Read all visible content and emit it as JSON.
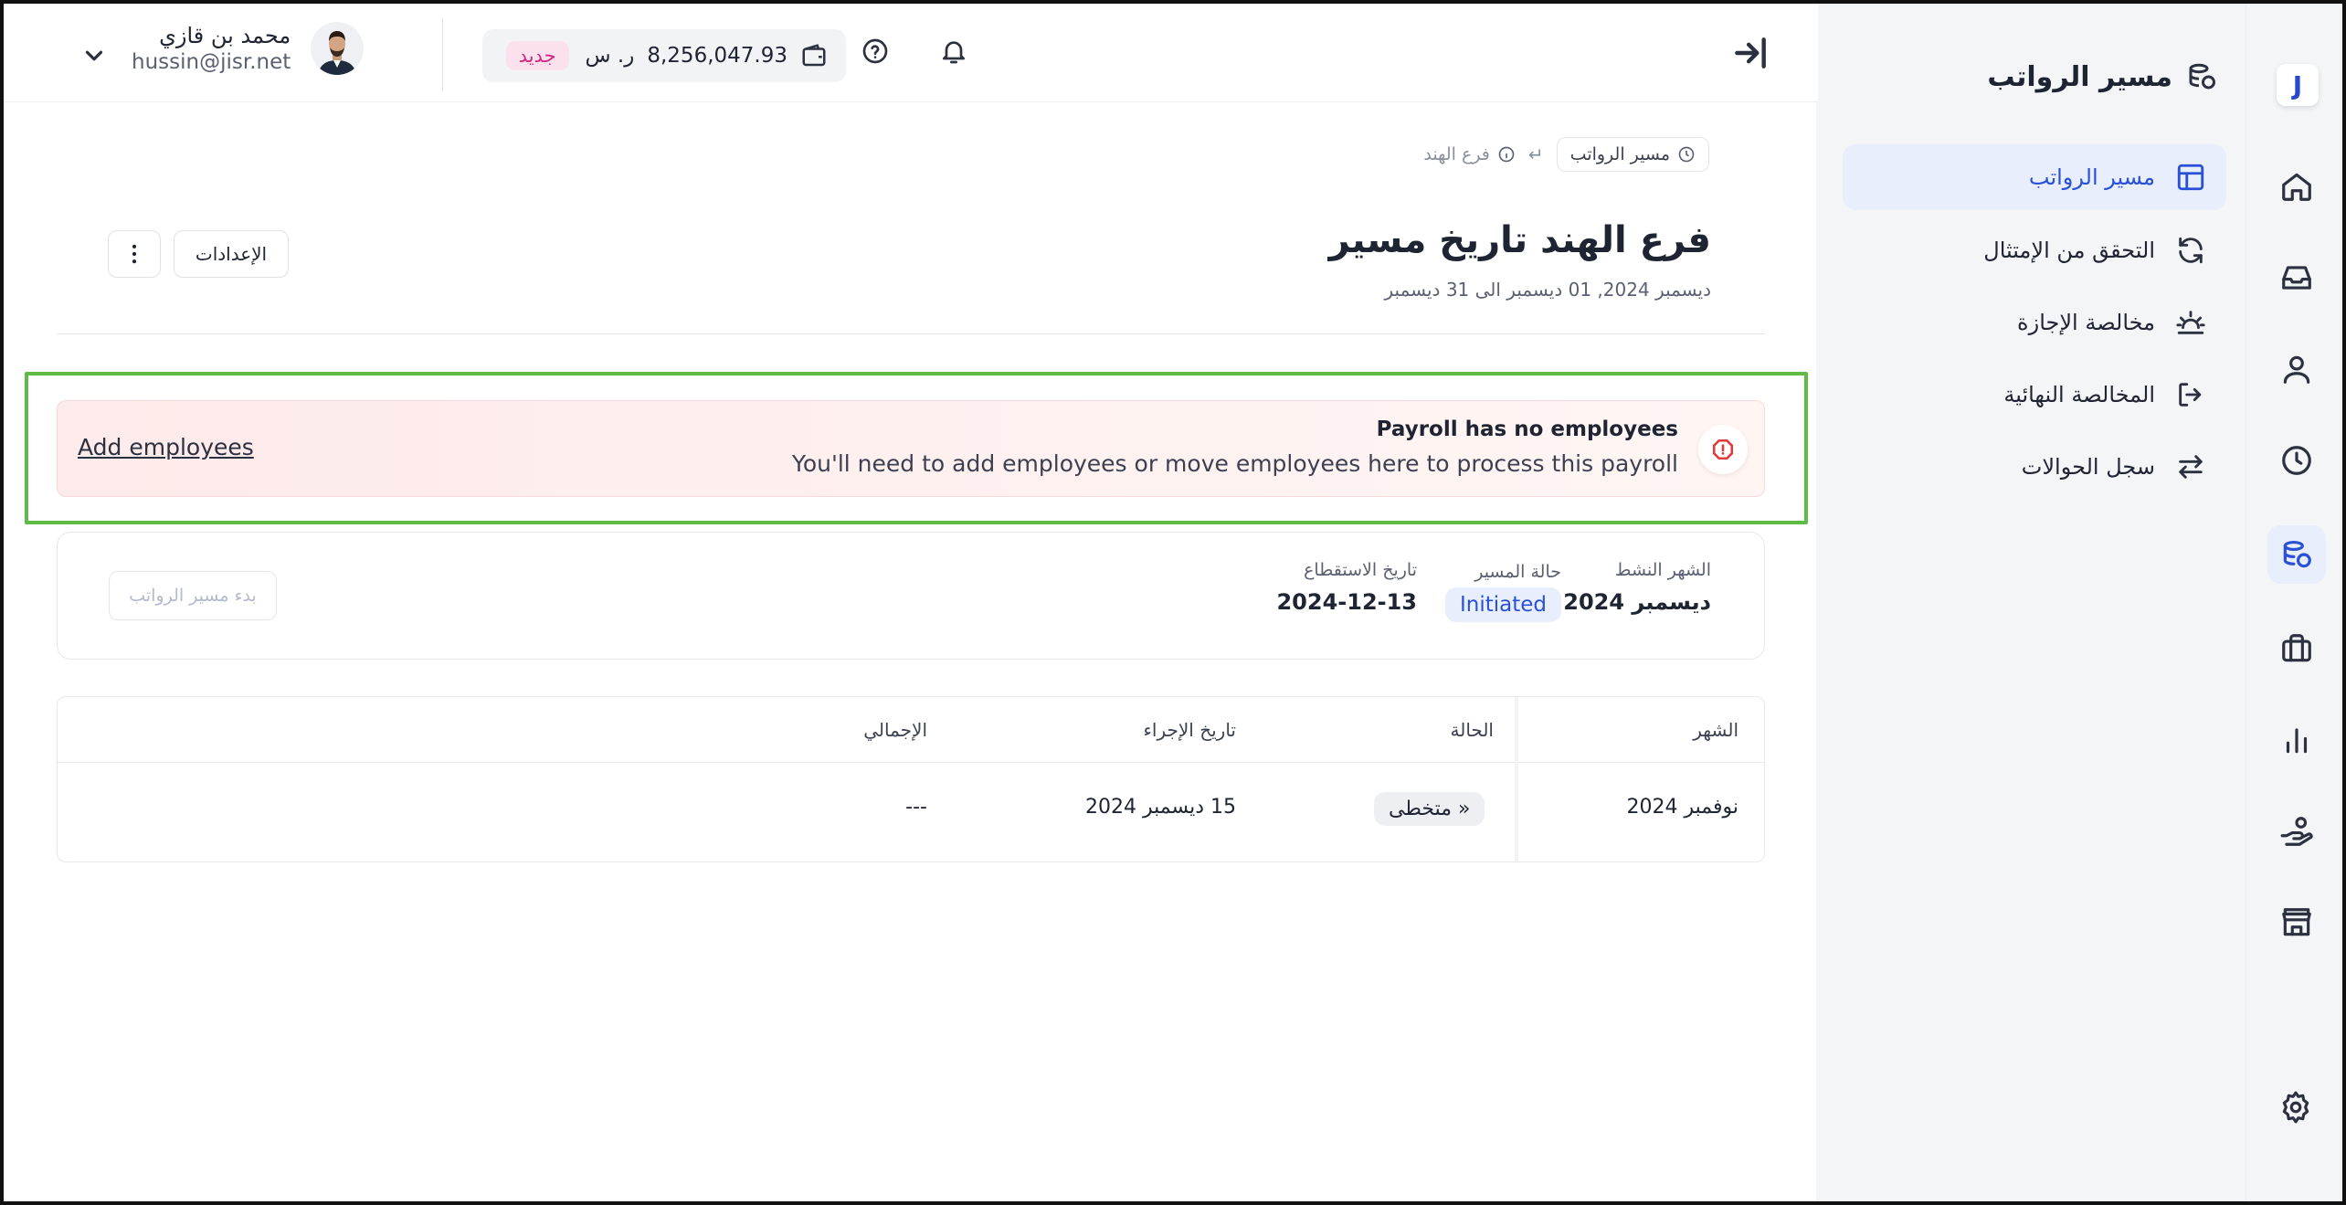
{
  "app": {
    "logo_letter": "J"
  },
  "sidebar": {
    "title": "مسير الرواتب",
    "items": [
      {
        "label": "مسير الرواتب",
        "icon": "table-icon",
        "active": true
      },
      {
        "label": "التحقق من الإمتثال",
        "icon": "refresh-icon",
        "active": false
      },
      {
        "label": "مخالصة الإجازة",
        "icon": "sunset-icon",
        "active": false
      },
      {
        "label": "المخالصة النهائية",
        "icon": "logout-icon",
        "active": false
      },
      {
        "label": "سجل الحوالات",
        "icon": "transfer-arrows-icon",
        "active": false
      }
    ]
  },
  "rail": {
    "icons": [
      "home-icon",
      "inbox-icon",
      "user-icon",
      "clock-icon",
      "coins-icon",
      "briefcase-icon",
      "bar-chart-icon",
      "hand-coin-icon",
      "store-icon",
      "settings-icon"
    ],
    "active": "coins-icon"
  },
  "topbar": {
    "balance": "8,256,047.93",
    "currency": "ر. س",
    "new_badge": "جديد",
    "user_name": "محمد بن قازي",
    "user_email": "hussin@jisr.net"
  },
  "breadcrumb": {
    "current": "مسير الرواتب",
    "parent": "فرع الهند"
  },
  "page": {
    "title": "فرع الهند تاريخ مسير",
    "subtitle": "ديسمبر 2024, 01 ديسمبر الى 31 ديسمبر",
    "settings_label": "الإعدادات"
  },
  "alert": {
    "title": "Payroll has no employees",
    "description": "You'll need to add employees or move employees here to process this payroll",
    "action": "Add employees",
    "accent_color": "#e03a3a"
  },
  "status": {
    "active_month_label": "الشهر النشط",
    "active_month_value": "ديسمبر 2024",
    "payroll_status_label": "حالة المسير",
    "payroll_status_value": "Initiated",
    "deduction_date_label": "تاريخ الاستقطاع",
    "deduction_date_value": "2024-12-13",
    "start_button": "بدء مسير الرواتب"
  },
  "table": {
    "headers": [
      "الشهر",
      "الحالة",
      "تاريخ الإجراء",
      "الإجمالي"
    ],
    "rows": [
      {
        "month": "نوفمبر 2024",
        "status": "« متخطى",
        "date": "15 ديسمبر 2024",
        "total": "---"
      }
    ]
  },
  "colors": {
    "accent": "#2950d6",
    "highlight": "#5dbb46"
  }
}
